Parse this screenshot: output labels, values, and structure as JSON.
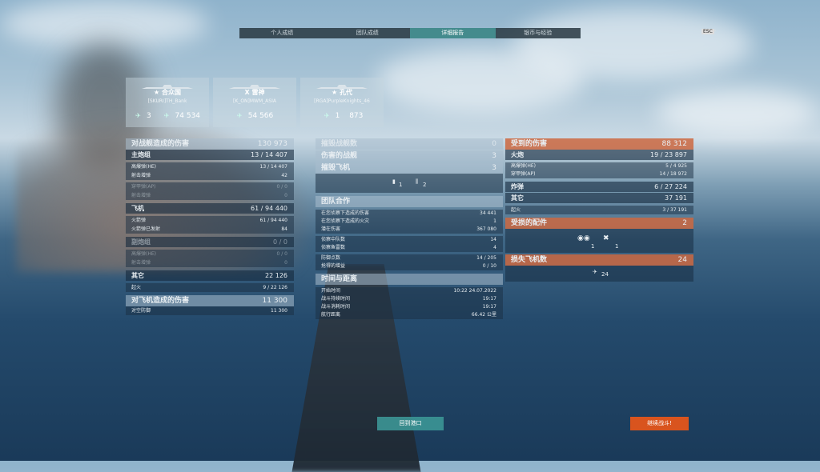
{
  "tabs": [
    {
      "label": "个人成绩",
      "active": false
    },
    {
      "label": "团队成绩",
      "active": false
    },
    {
      "label": "详细报告",
      "active": true
    },
    {
      "label": "银币与经验",
      "active": false
    }
  ],
  "esc_label": "ESC",
  "ships": [
    {
      "name": "★ 合众国",
      "player": "[SKURI]TH_Bank",
      "stat1": "3",
      "stat2": "74 534",
      "icon1": "plane-destroy-icon",
      "icon2": "plane-icon"
    },
    {
      "name": "X 雷神",
      "player": "[K_ON]MWM_ASIA",
      "stat1": "",
      "stat2": "54 566",
      "icon1": "",
      "icon2": "plane-icon"
    },
    {
      "name": "★ 孔代",
      "player": "[RGA]PurpleKnights_46",
      "stat1": "1",
      "stat2": "873",
      "icon1": "plane-icon",
      "icon2": ""
    }
  ],
  "left": {
    "damage_header": {
      "label": "对战舰造成的伤害",
      "value": "130 973"
    },
    "main_battery": {
      "label": "主炮组",
      "value": "13 / 14 407"
    },
    "main_rows": [
      {
        "label": "高爆弹(HE)",
        "value": "13 / 14 407",
        "dim": false
      },
      {
        "label": "射击增弹",
        "value": "42",
        "dim": false
      },
      {
        "label": "穿甲弹(AP)",
        "value": "0 / 0",
        "dim": true
      },
      {
        "label": "射击增弹",
        "value": "0",
        "dim": true
      }
    ],
    "aircraft": {
      "label": "飞机",
      "value": "61 / 94 440"
    },
    "aircraft_rows": [
      {
        "label": "火箭弹",
        "value": "61 / 94 440",
        "dim": false
      },
      {
        "label": "火箭弹已发射",
        "value": "84",
        "dim": false
      }
    ],
    "secondary": {
      "label": "副炮组",
      "value": "0 / 0"
    },
    "secondary_rows": [
      {
        "label": "高爆弹(HE)",
        "value": "0 / 0",
        "dim": true
      },
      {
        "label": "射击增弹",
        "value": "0",
        "dim": true
      }
    ],
    "other": {
      "label": "其它",
      "value": "22 126"
    },
    "other_rows": [
      {
        "label": "起火",
        "value": "9 / 22 126",
        "dim": false
      }
    ],
    "aa_header": {
      "label": "对飞机造成的伤害",
      "value": "11 300"
    },
    "aa_rows": [
      {
        "label": "对空防御",
        "value": "11 300",
        "dim": false
      }
    ]
  },
  "middle": {
    "destroyed_ships": {
      "label": "摧毁战舰数",
      "value": "0"
    },
    "damaged_ships": {
      "label": "伤害的战舰",
      "value": "3"
    },
    "destroyed_planes": {
      "label": "摧毁飞机",
      "value": "3"
    },
    "plane_icons": [
      {
        "icon": "fighter-icon",
        "value": "1"
      },
      {
        "icon": "bomber-icon",
        "value": "2"
      }
    ],
    "team_header": "团队合作",
    "team_rows": [
      {
        "label": "在您侦察下造成的伤害",
        "value": "34 441"
      },
      {
        "label": "在您侦察下造成的火灾",
        "value": "1"
      },
      {
        "label": "潜在伤害",
        "value": "367 080"
      },
      {
        "label": "侦察中队数",
        "value": "14"
      },
      {
        "label": "侦察鱼雷数",
        "value": "4"
      },
      {
        "label": "防御点数",
        "value": "14 / 205"
      },
      {
        "label": "抢得的增益",
        "value": "0 / 10"
      }
    ],
    "time_header": "时间与距离",
    "time_rows": [
      {
        "label": "开始时间",
        "value": "10:22   24.07.2022"
      },
      {
        "label": "战斗持续时间",
        "value": "19:17"
      },
      {
        "label": "战斗消耗时间",
        "value": "19:17"
      },
      {
        "label": "航行距离",
        "value": "66.42  公里"
      }
    ]
  },
  "right": {
    "received_header": {
      "label": "受到的伤害",
      "value": "88 312"
    },
    "guns": {
      "label": "火炮",
      "value": "19 / 23 897"
    },
    "guns_rows": [
      {
        "label": "高爆弹(HE)",
        "value": "5 / 4 925"
      },
      {
        "label": "穿甲弹(AP)",
        "value": "14 / 18 972"
      }
    ],
    "bombs": {
      "label": "炸弹",
      "value": "6 / 27 224"
    },
    "other": {
      "label": "其它",
      "value": "37 191"
    },
    "other_rows": [
      {
        "label": "起火",
        "value": "3 / 37 191"
      }
    ],
    "modules_header": {
      "label": "受损的配件",
      "value": "2"
    },
    "module_icons": [
      {
        "icon": "engine-icon",
        "value": "1"
      },
      {
        "icon": "aa-gun-icon",
        "value": "1"
      }
    ],
    "planes_lost_header": {
      "label": "损失飞机数",
      "value": "24"
    },
    "planes_lost_icon": {
      "icon": "plane-lost-icon",
      "value": "24"
    }
  },
  "buttons": {
    "port": "回到港口",
    "continue": "继续战斗!"
  }
}
